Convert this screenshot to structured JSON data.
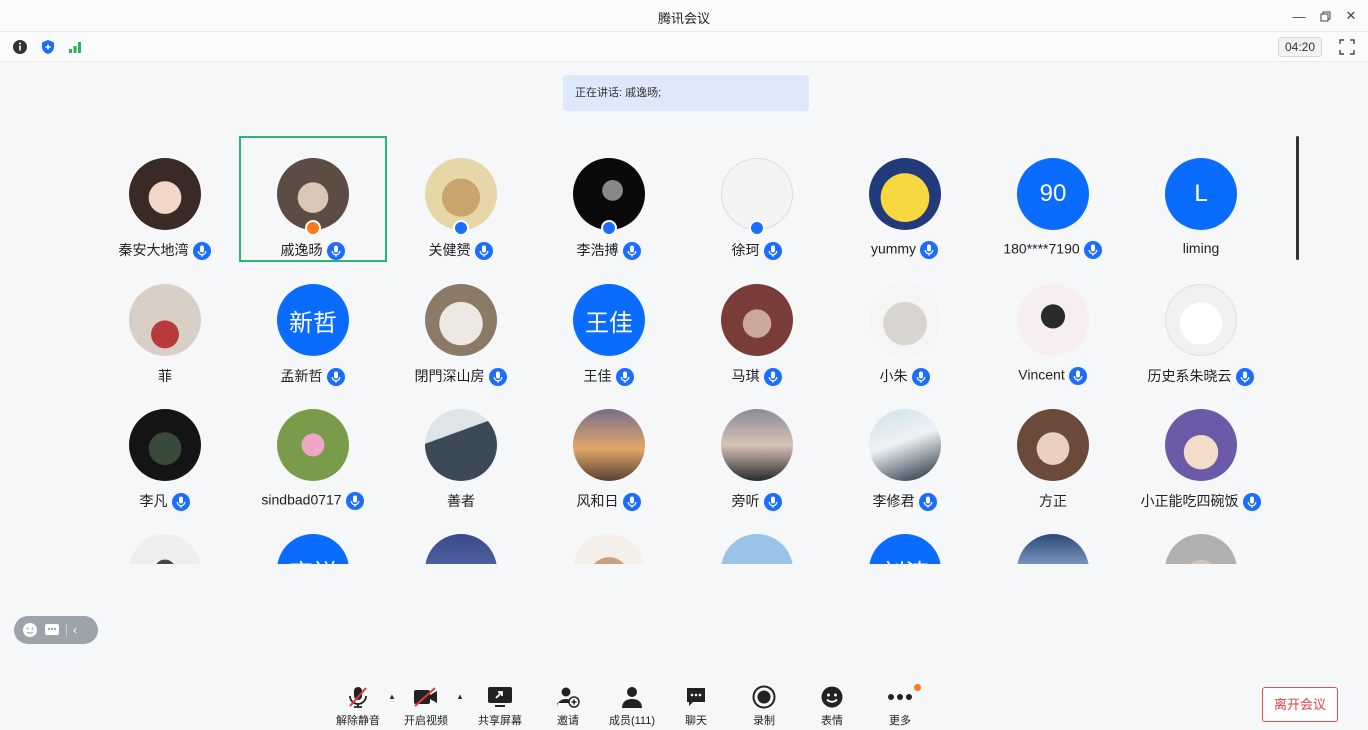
{
  "window": {
    "title": "腾讯会议"
  },
  "header": {
    "timer": "04:20"
  },
  "speaking": {
    "text": "正在讲话: 戚逸旸;"
  },
  "participants": [
    {
      "name": "秦安大地湾"
    },
    {
      "name": "戚逸旸"
    },
    {
      "name": "关健赟"
    },
    {
      "name": "李浩搏"
    },
    {
      "name": "徐珂"
    },
    {
      "name": "yummy"
    },
    {
      "name": "180****7190",
      "avatar_text": "90"
    },
    {
      "name": "liming",
      "avatar_text": "L"
    },
    {
      "name": "菲"
    },
    {
      "name": "孟新哲",
      "avatar_text": "新哲"
    },
    {
      "name": "閉門深山房"
    },
    {
      "name": "王佳",
      "avatar_text": "王佳"
    },
    {
      "name": "马琪"
    },
    {
      "name": "小朱"
    },
    {
      "name": "Vincent"
    },
    {
      "name": "历史系朱晓云"
    },
    {
      "name": "李凡"
    },
    {
      "name": "sindbad0717"
    },
    {
      "name": "善者"
    },
    {
      "name": "风和日"
    },
    {
      "name": "旁听"
    },
    {
      "name": "李修君"
    },
    {
      "name": "方正"
    },
    {
      "name": "小正能吃四碗饭"
    },
    {
      "name": ""
    },
    {
      "name": "",
      "avatar_text": "齐祥"
    },
    {
      "name": ""
    },
    {
      "name": ""
    },
    {
      "name": ""
    },
    {
      "name": "",
      "avatar_text": "刘涛"
    },
    {
      "name": ""
    },
    {
      "name": ""
    }
  ],
  "toolbar": {
    "unmute": "解除静音",
    "video": "开启视频",
    "share": "共享屏幕",
    "invite": "邀请",
    "members": "成员(111)",
    "chat": "聊天",
    "record": "录制",
    "emoji": "表情",
    "more": "更多",
    "leave": "离开会议"
  },
  "colors": {
    "accent": "#0a6cff",
    "active_border": "#2bb673",
    "danger": "#e04040"
  }
}
